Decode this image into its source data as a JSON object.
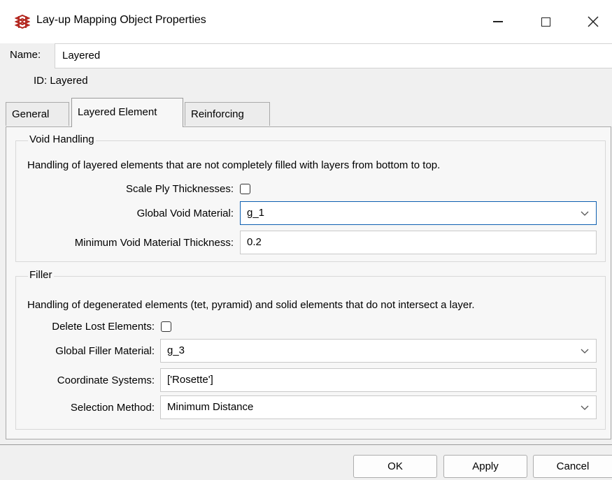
{
  "window": {
    "title": "Lay-up Mapping Object Properties",
    "icon": "acp-app-icon"
  },
  "name_row": {
    "label": "Name:",
    "value": "Layered"
  },
  "id_row": {
    "text": "ID: Layered"
  },
  "tabs": [
    {
      "label": "General",
      "selected": false
    },
    {
      "label": "Layered Element",
      "selected": true
    },
    {
      "label": "Reinforcing",
      "selected": false
    }
  ],
  "void_handling": {
    "title": "Void Handling",
    "description": "Handling of layered elements that are not completely filled with layers from bottom to top.",
    "scale_ply_label": "Scale Ply Thicknesses:",
    "scale_ply_checked": false,
    "global_void_label": "Global Void Material:",
    "global_void_value": "g_1",
    "min_void_label": "Minimum Void Material Thickness:",
    "min_void_value": "0.2"
  },
  "filler": {
    "title": "Filler",
    "description": "Handling of degenerated elements (tet, pyramid) and solid elements that do not intersect a layer.",
    "delete_lost_label": "Delete Lost Elements:",
    "delete_lost_checked": false,
    "global_filler_label": "Global Filler Material:",
    "global_filler_value": "g_3",
    "coord_sys_label": "Coordinate Systems:",
    "coord_sys_value": "['Rosette']",
    "selection_method_label": "Selection Method:",
    "selection_method_value": "Minimum Distance"
  },
  "buttons": {
    "ok": "OK",
    "apply": "Apply",
    "cancel": "Cancel"
  },
  "colors": {
    "accent_focus": "#0d5eb0",
    "icon_red": "#b3261e"
  }
}
